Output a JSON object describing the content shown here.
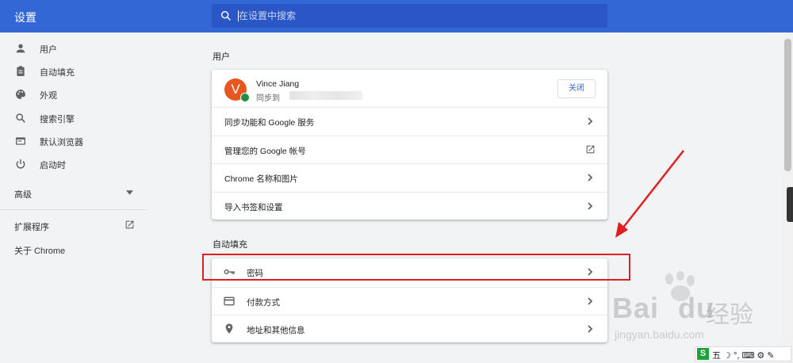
{
  "app": {
    "title": "设置"
  },
  "search": {
    "placeholder": "在设置中搜索"
  },
  "sidebar": {
    "items": [
      {
        "label": "用户",
        "icon": "person-icon"
      },
      {
        "label": "自动填充",
        "icon": "clipboard-icon"
      },
      {
        "label": "外观",
        "icon": "palette-icon"
      },
      {
        "label": "搜索引擎",
        "icon": "search-icon"
      },
      {
        "label": "默认浏览器",
        "icon": "browser-icon"
      },
      {
        "label": "启动时",
        "icon": "power-icon"
      }
    ],
    "advanced": "高级",
    "extensions": "扩展程序",
    "about": "关于 Chrome"
  },
  "people": {
    "section_title": "用户",
    "user": {
      "initial": "V",
      "name": "Vince Jiang",
      "sync_prefix": "同步到",
      "close_label": "关闭"
    },
    "rows": [
      "同步功能和 Google 服务",
      "管理您的 Google 帐号",
      "Chrome 名称和图片",
      "导入书签和设置"
    ]
  },
  "autofill": {
    "section_title": "自动填充",
    "rows": [
      {
        "label": "密码",
        "icon": "key-icon"
      },
      {
        "label": "付款方式",
        "icon": "credit-card-icon"
      },
      {
        "label": "地址和其他信息",
        "icon": "location-pin-icon"
      }
    ]
  },
  "watermark": {
    "brand": "Bai",
    "brand2": "du",
    "cn": "经验",
    "url": "jingyan.baidu.com"
  },
  "ime": {
    "s": "S",
    "text": "五 ☽ °, ⌨ ⚙ ✎"
  },
  "colors": {
    "header": "#3367d6",
    "accent": "#3367d6",
    "highlight": "#e02020",
    "avatar": "#e8551f"
  }
}
